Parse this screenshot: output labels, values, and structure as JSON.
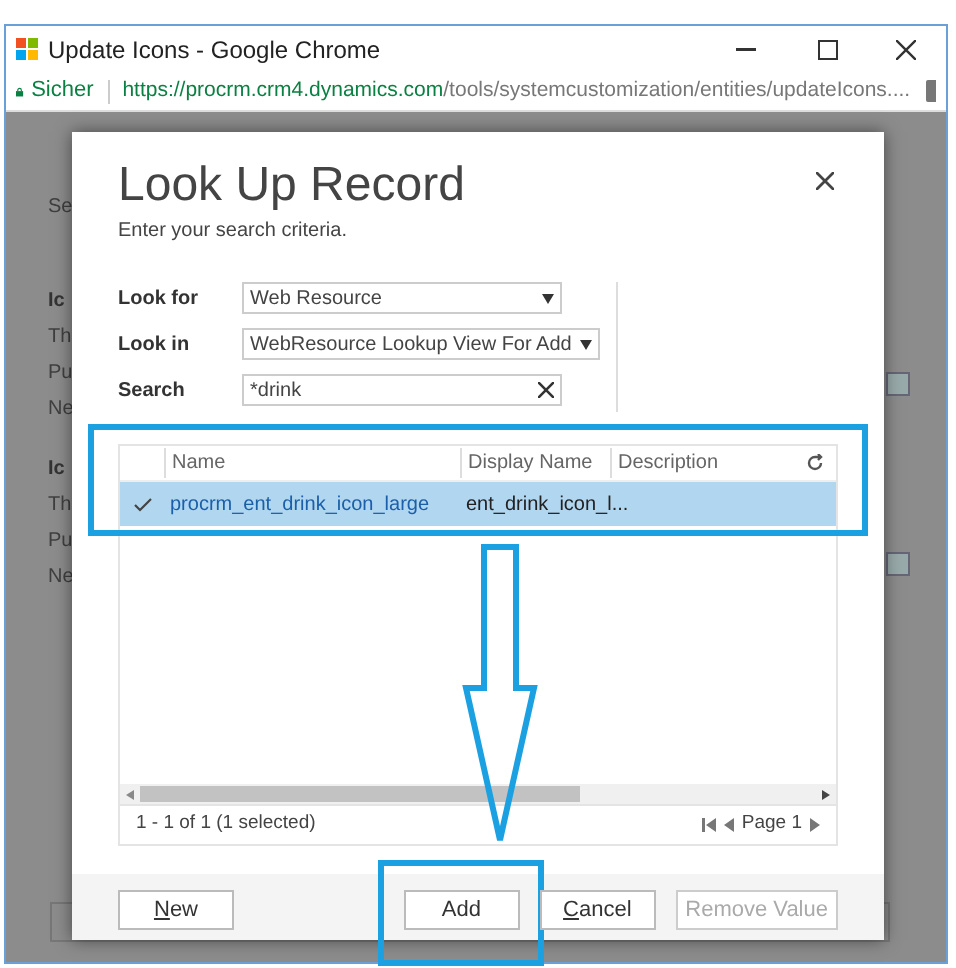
{
  "window": {
    "title": "Update Icons - Google Chrome"
  },
  "address_bar": {
    "security": "Sicher",
    "url_host": "https://procrm.crm4.dynamics.com",
    "url_path": "/tools/systemcustomization/entities/updateIcons...."
  },
  "background_page": {
    "subtitle": "Se",
    "lines": [
      {
        "text": "Ic",
        "kind": "bold"
      },
      {
        "text": "Th",
        "kind": "plain"
      },
      {
        "text": "Pu",
        "kind": "plain"
      },
      {
        "text": "Ne",
        "kind": "plain"
      },
      {
        "text": "Ic",
        "kind": "bold"
      },
      {
        "text": "Th",
        "kind": "plain"
      },
      {
        "text": "Pu",
        "kind": "plain"
      },
      {
        "text": "Ne",
        "kind": "plain"
      }
    ]
  },
  "dialog": {
    "title": "Look Up Record",
    "subtitle": "Enter your search criteria.",
    "fields": [
      {
        "label": "Look for",
        "value": "Web Resource",
        "kind": "dropdown"
      },
      {
        "label": "Look in",
        "value": "WebResource Lookup View For Add",
        "kind": "dropdown"
      },
      {
        "label": "Search",
        "value": "*drink",
        "kind": "search"
      }
    ],
    "table": {
      "columns": [
        "Name",
        "Display Name",
        "Description"
      ],
      "rows": [
        {
          "cells": [
            "procrm_ent_drink_icon_large",
            "ent_drink_icon_l..."
          ],
          "selected": true
        }
      ]
    },
    "status": "1 - 1 of 1 (1 selected)",
    "pager": "Page 1",
    "buttons": [
      {
        "label": "New",
        "disabled": false,
        "highlighted": false
      },
      {
        "label": "Add",
        "disabled": false,
        "highlighted": true
      },
      {
        "label": "Cancel",
        "disabled": false,
        "highlighted": false
      },
      {
        "label": "Remove Value",
        "disabled": true,
        "highlighted": false
      }
    ]
  }
}
